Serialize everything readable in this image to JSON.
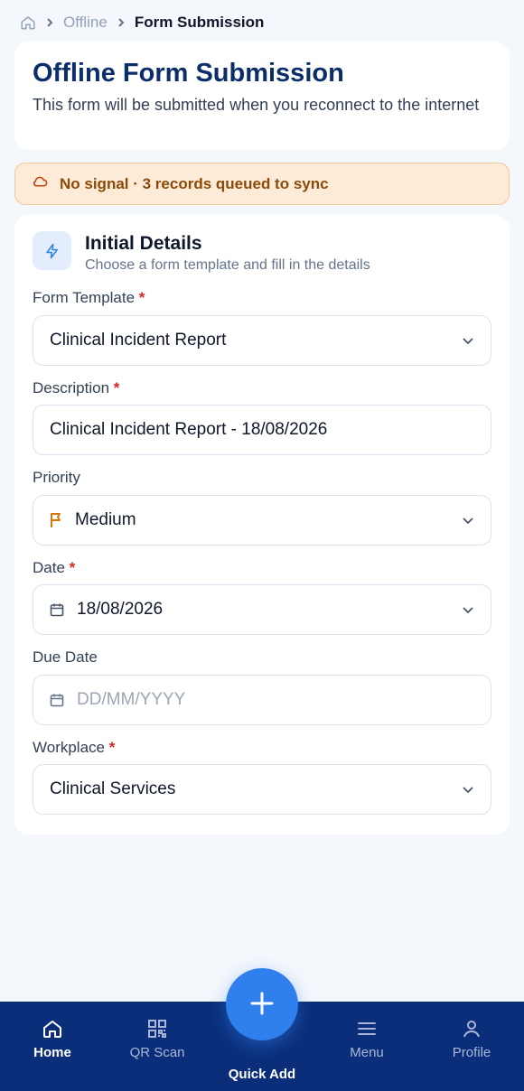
{
  "breadcrumb": {
    "home_icon": "home-icon",
    "parent": "Offline",
    "current": "Form Submission"
  },
  "header": {
    "title": "Offline Form Submission",
    "subtitle": "This form will be submitted when you reconnect to the internet"
  },
  "alert": {
    "icon": "cloud-off-icon",
    "text": "No signal · 3 records queued to sync",
    "color": "#8a4b0a"
  },
  "section": {
    "icon": "lightning-icon",
    "title": "Initial Details",
    "subtitle": "Choose a form template and fill in the details"
  },
  "fields": {
    "template": {
      "label": "Form Template",
      "required": "*",
      "value": "Clinical Incident Report"
    },
    "description": {
      "label": "Description",
      "required": "*",
      "value": "Clinical Incident Report - 18/08/2026"
    },
    "priority": {
      "label": "Priority",
      "value": "Medium",
      "icon": "flag-icon"
    },
    "date": {
      "label": "Date",
      "required": "*",
      "value": "18/08/2026",
      "icon": "calendar-icon"
    },
    "due_date": {
      "label": "Due Date",
      "placeholder": "DD/MM/YYYY",
      "icon": "calendar-icon"
    },
    "workplace": {
      "label": "Workplace",
      "required": "*",
      "value": "Clinical Services"
    }
  },
  "nav": {
    "home": "Home",
    "qr": "QR Scan",
    "quick_add": "Quick Add",
    "menu": "Menu",
    "profile": "Profile"
  },
  "colors": {
    "primary": "#0b2e7a",
    "accent": "#2f80ed",
    "required": "#dc2626",
    "alert_bg": "#fdebd8"
  }
}
